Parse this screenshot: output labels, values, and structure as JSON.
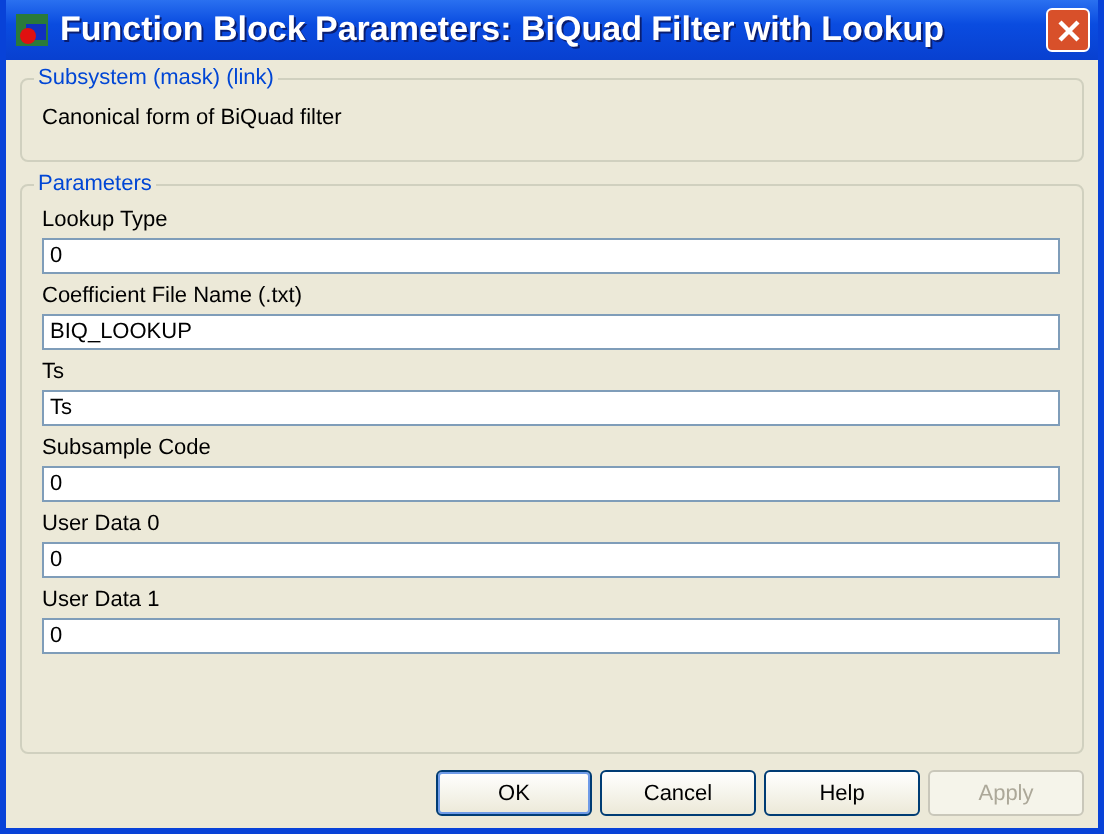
{
  "window": {
    "title": "Function Block Parameters: BiQuad Filter with Lookup"
  },
  "description_group": {
    "title": "Subsystem (mask) (link)",
    "text": "Canonical form of BiQuad filter"
  },
  "parameters_group": {
    "title": "Parameters",
    "fields": [
      {
        "label": "Lookup Type",
        "value": "0"
      },
      {
        "label": "Coefficient File Name (.txt)",
        "value": "BIQ_LOOKUP"
      },
      {
        "label": "Ts",
        "value": "Ts"
      },
      {
        "label": "Subsample Code",
        "value": "0"
      },
      {
        "label": "User Data 0",
        "value": "0"
      },
      {
        "label": "User Data 1",
        "value": "0"
      }
    ]
  },
  "buttons": [
    {
      "label": "OK",
      "default": true,
      "disabled": false
    },
    {
      "label": "Cancel",
      "default": false,
      "disabled": false
    },
    {
      "label": "Help",
      "default": false,
      "disabled": false
    },
    {
      "label": "Apply",
      "default": false,
      "disabled": true
    }
  ]
}
